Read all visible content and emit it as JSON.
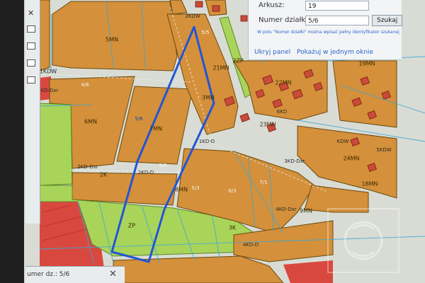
{
  "search_panel": {
    "sheet_label": "Arkusz:",
    "sheet_value": "19",
    "parcel_label": "Numer działki:",
    "parcel_value": "5/6",
    "search_button": "Szukaj",
    "hint": "W polu \"Numer działki\" można wpisać pełny identyfikator szukanej",
    "hide_panel_link": "Ukryj panel",
    "show_in_window_link": "Pokażuj w jednym oknie"
  },
  "left_panel": {
    "close_symbol": "✕"
  },
  "bottom_tab": {
    "label": "umer dz.: 5/6",
    "close_symbol": "✕"
  },
  "map_labels": {
    "z_5mn": "5MN",
    "z_1kdw": "1KDW",
    "z_kdz": "KD-Dxr",
    "z_6mn": "6MN",
    "z_7mn": "7MN",
    "z_2kdx": "2KD-Dxr",
    "z_2k": "2K",
    "z_2kdd": "2KD-D",
    "z_8mn": "8MN",
    "z_1kdd": "1KD-D",
    "z_3mn": "3MN",
    "z_2zp": "2ZP",
    "z_21mn": "21MN",
    "z_22mn": "22MN",
    "z_23mn": "23MN",
    "z_6kd": "6KD",
    "z_19mn": "19MN",
    "z_24mn": "24MN",
    "z_3kdx": "3KD-Dxr",
    "z_4kdx": "4KD-Dxr",
    "z_9mn": "9MN",
    "z_3k": "3K",
    "z_zp": "ZP",
    "z_4kdd": "4KD-D",
    "z_2kdw": "2KDW",
    "z_5kdw": "5KDW",
    "z_kdw2": "KDW",
    "z_18mn": "18MN",
    "p_58": "5/8",
    "p_56": "5/6",
    "p_55": "5/5",
    "p_63": "6/3",
    "p_71": "7/1",
    "p_48": "4/8",
    "p_53": "5/3"
  },
  "colors": {
    "zone_mn": "#d4903a",
    "road": "#d9dcd4",
    "green": "#a9d45a",
    "commercial": "#d9483e",
    "parcel_highlight": "#2255d6",
    "parcel_lines": "#3aa7d8"
  },
  "icons": [
    "print-icon",
    "layers-icon",
    "measure-icon",
    "info-icon",
    "close-icon"
  ]
}
